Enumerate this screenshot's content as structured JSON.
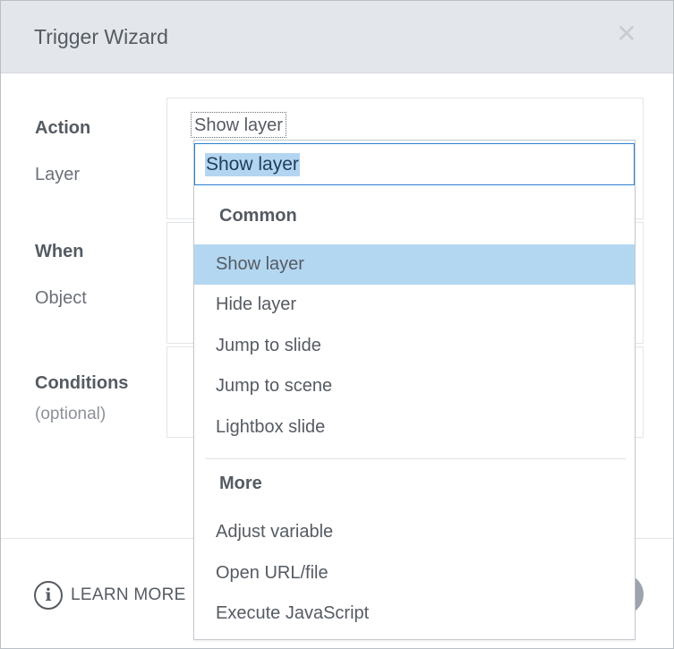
{
  "dialog": {
    "title": "Trigger Wizard",
    "close_glyph": "✕"
  },
  "form": {
    "action_label": "Action",
    "layer_label": "Layer",
    "when_label": "When",
    "object_label": "Object",
    "conditions_label": "Conditions",
    "optional_label": "(optional)",
    "action_value": "Show layer"
  },
  "dropdown": {
    "search_value": "Show layer",
    "groups": [
      {
        "header": "Common",
        "options": [
          "Show layer",
          "Hide layer",
          "Jump to slide",
          "Jump to scene",
          "Lightbox slide"
        ]
      },
      {
        "header": "More",
        "options": [
          "Adjust variable",
          "Open URL/file",
          "Execute JavaScript"
        ]
      }
    ],
    "selected_option": "Show layer"
  },
  "footer": {
    "learn_more_label": "LEARN MORE",
    "info_icon_glyph": "i"
  },
  "colors": {
    "titlebar_bg": "#e3e6ea",
    "selection_bg": "#b3d7f1",
    "focus_border": "#2b7fd1"
  }
}
